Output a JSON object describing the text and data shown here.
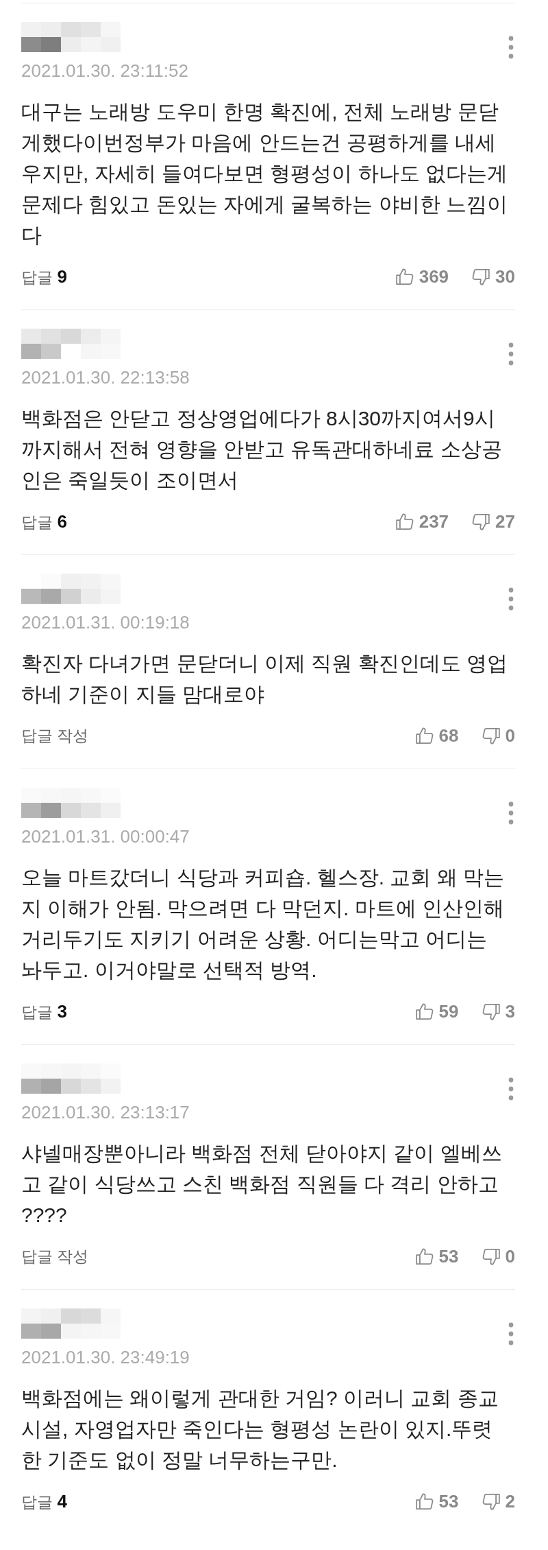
{
  "comments": [
    {
      "date": "2021.01.30. 23:11:52",
      "text": "대구는 노래방 도우미 한명 확진에, 전체 노래방 문닫게했다이번정부가 마음에 안드는건 공평하게를 내세우지만, 자세히 들여다보면 형평성이 하나도 없다는게 문제다 힘있고 돈있는 자에게 굴복하는 야비한 느낌이다",
      "reply": "답글 **9**",
      "likes": "369",
      "dislikes": "30"
    },
    {
      "date": "2021.01.30. 22:13:58",
      "text": "백화점은 안닫고 정상영업에다가 8시30까지여서9시까지해서 전혀 영향을 안받고 유독관대하네료 소상공인은 죽일듯이 조이면서",
      "reply": "답글 **6**",
      "likes": "237",
      "dislikes": "27"
    },
    {
      "date": "2021.01.31. 00:19:18",
      "text": "확진자 다녀가면 문닫더니 이제 직원 확진인데도 영업하네 기준이 지들 맘대로야",
      "reply": "답글 작성",
      "likes": "68",
      "dislikes": "0"
    },
    {
      "date": "2021.01.31. 00:00:47",
      "text": "오늘 마트갔더니 식당과 커피숍. 헬스장. 교회 왜 막는지 이해가 안됨. 막으려면 다 막던지. 마트에 인산인해 거리두기도 지키기 어려운 상황. 어디는막고 어디는 놔두고. 이거야말로 선택적 방역.",
      "reply": "답글 **3**",
      "likes": "59",
      "dislikes": "3"
    },
    {
      "date": "2021.01.30. 23:13:17",
      "text": "샤넬매장뿐아니라 백화점 전체 닫아야지 같이 엘베쓰고 같이 식당쓰고 스친 백화점 직원들 다 격리 안하고 ????",
      "reply": "답글 작성",
      "likes": "53",
      "dislikes": "0"
    },
    {
      "date": "2021.01.30. 23:49:19",
      "text": "백화점에는 왜이렇게 관대한 거임? 이러니 교회 종교시설, 자영업자만 죽인다는 형평성 논란이 있지.뚜렷한 기준도 없이 정말 너무하는구만.",
      "reply": "답글 **4**",
      "likes": "53",
      "dislikes": "2"
    }
  ]
}
